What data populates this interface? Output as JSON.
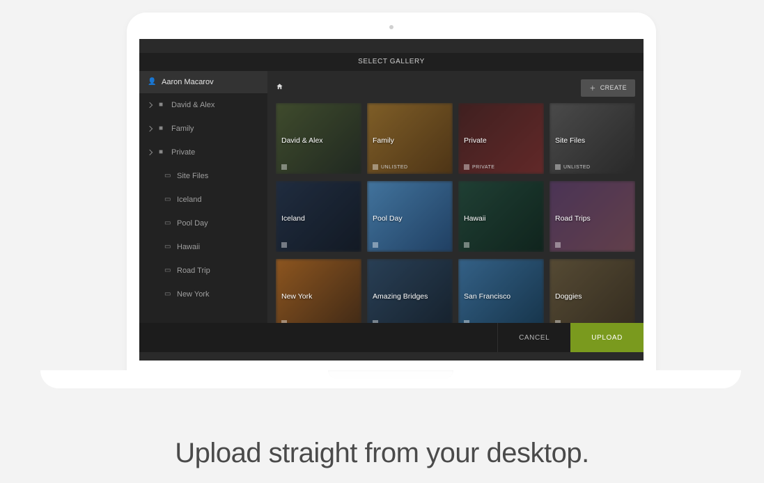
{
  "headline": "Upload straight from your desktop.",
  "modal": {
    "title": "SELECT GALLERY",
    "user": "Aaron Macarov",
    "create_label": "CREATE",
    "cancel_label": "CANCEL",
    "upload_label": "UPLOAD"
  },
  "sidebar": {
    "folders": [
      {
        "label": "David & Alex"
      },
      {
        "label": "Family"
      },
      {
        "label": "Private"
      }
    ],
    "galleries": [
      {
        "label": "Site Files"
      },
      {
        "label": "Iceland"
      },
      {
        "label": "Pool Day"
      },
      {
        "label": "Hawaii"
      },
      {
        "label": "Road Trip"
      },
      {
        "label": "New York"
      }
    ]
  },
  "cards": [
    {
      "title": "David & Alex",
      "badge": "",
      "grad": "linear-gradient(135deg,#5a6b3f,#2e3a2f)"
    },
    {
      "title": "Family",
      "badge": "UNLISTED",
      "grad": "linear-gradient(135deg,#b58638,#6e4a1f)"
    },
    {
      "title": "Private",
      "badge": "PRIVATE",
      "grad": "linear-gradient(135deg,#5a2d2d,#8c3a3a)"
    },
    {
      "title": "Site Files",
      "badge": "UNLISTED",
      "grad": "linear-gradient(135deg,#6a6a6a,#3a3a3a)"
    },
    {
      "title": "Iceland",
      "badge": "",
      "grad": "linear-gradient(135deg,#2d3f5a,#1a2433)"
    },
    {
      "title": "Pool Day",
      "badge": "",
      "grad": "linear-gradient(135deg,#5ea5e0,#2d5a8c)"
    },
    {
      "title": "Hawaii",
      "badge": "",
      "grad": "linear-gradient(135deg,#2d5a4a,#163329)"
    },
    {
      "title": "Road Trips",
      "badge": "",
      "grad": "linear-gradient(135deg,#6a4a7a,#8c5a6a)"
    },
    {
      "title": "New York",
      "badge": "",
      "grad": "linear-gradient(135deg,#c97a2d,#5a3a1f)"
    },
    {
      "title": "Amazing Bridges",
      "badge": "",
      "grad": "linear-gradient(135deg,#3a5a7a,#1f2f3f)"
    },
    {
      "title": "San Francisco",
      "badge": "",
      "grad": "linear-gradient(135deg,#4a8ac0,#1f4a6a)"
    },
    {
      "title": "Doggies",
      "badge": "",
      "grad": "linear-gradient(135deg,#7a6a4a,#4a3f2d)"
    }
  ]
}
